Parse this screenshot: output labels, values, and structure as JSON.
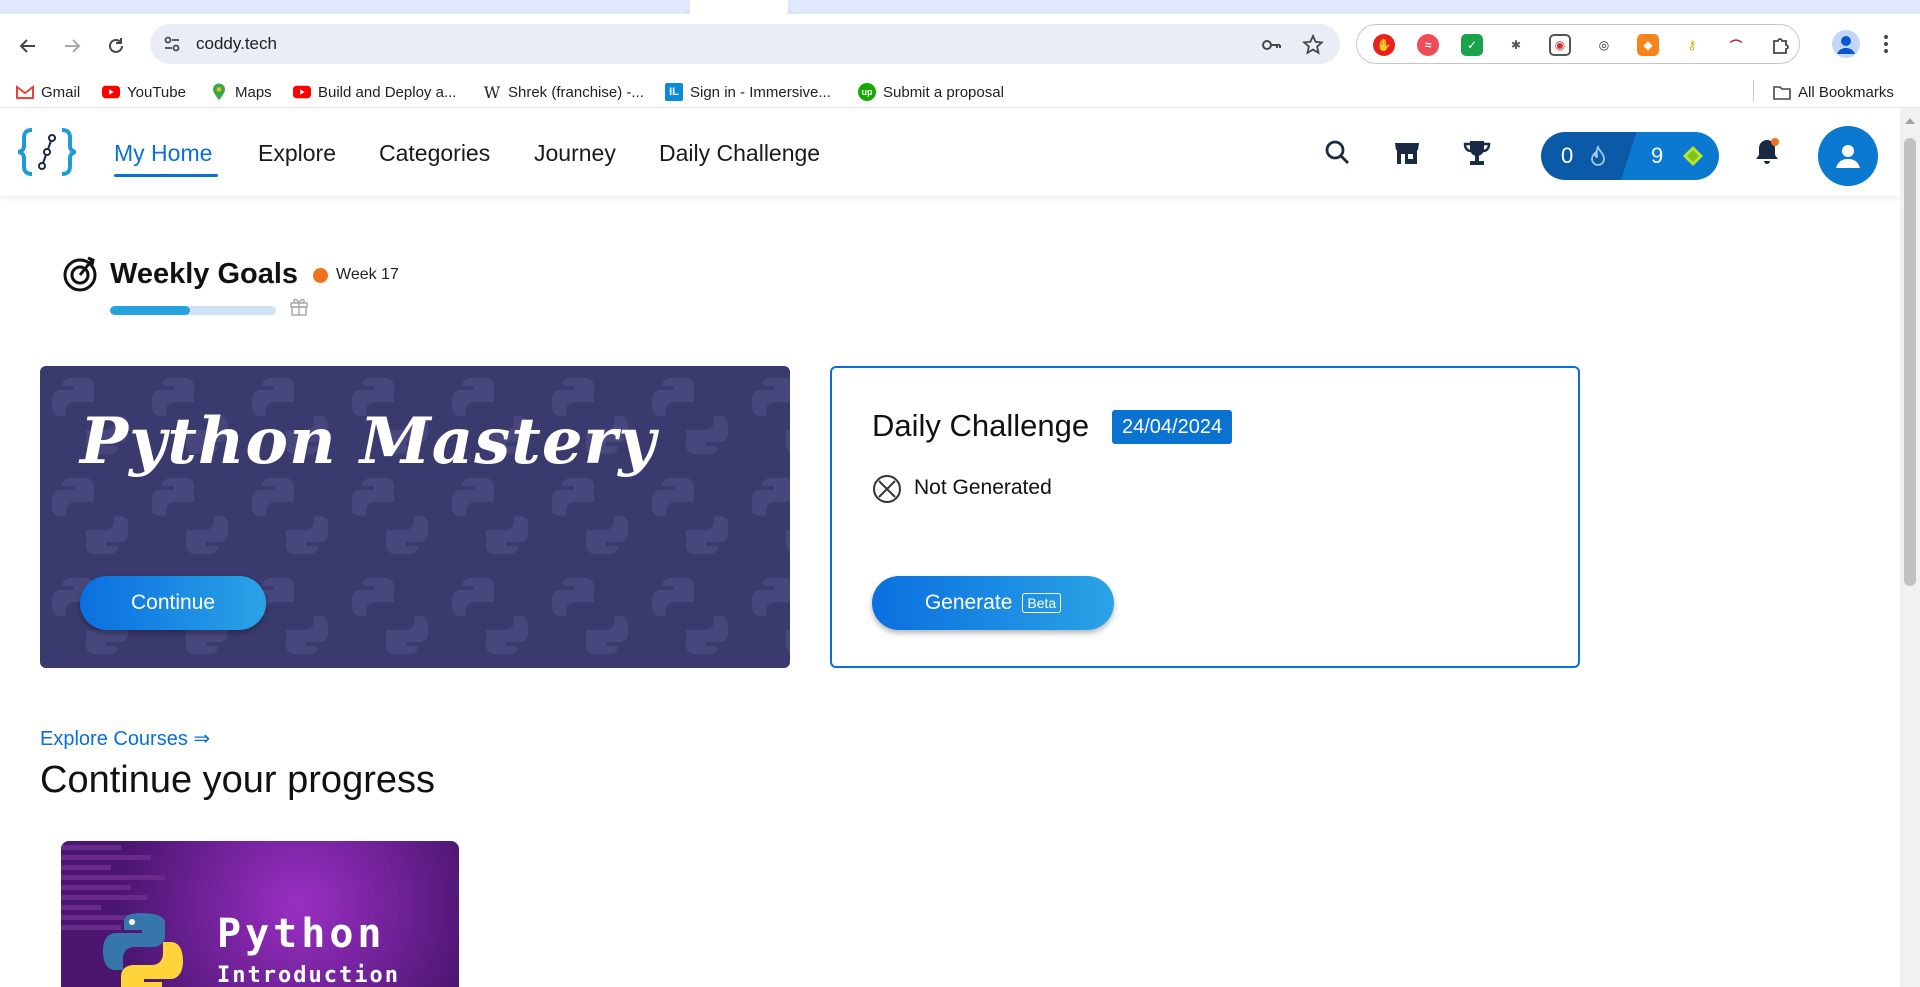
{
  "browser": {
    "url": "coddy.tech",
    "bookmarks": [
      {
        "label": "Gmail",
        "icon": "gmail-icon"
      },
      {
        "label": "YouTube",
        "icon": "youtube-icon"
      },
      {
        "label": "Maps",
        "icon": "maps-icon"
      },
      {
        "label": "Build and Deploy a...",
        "icon": "youtube-icon"
      },
      {
        "label": "Shrek (franchise) -...",
        "icon": "wikipedia-icon"
      },
      {
        "label": "Sign in - Immersive...",
        "icon": "immersive-icon"
      },
      {
        "label": "Submit a proposal",
        "icon": "upwork-icon"
      }
    ],
    "all_bookmarks": "All Bookmarks"
  },
  "header": {
    "nav": [
      "My Home",
      "Explore",
      "Categories",
      "Journey",
      "Daily Challenge"
    ],
    "active_nav": "My Home",
    "streak": "0",
    "gems": "9",
    "colors": {
      "accent": "#0a6fd6",
      "pill_dark": "#0a5aa8",
      "pill_light": "#0b79d0"
    }
  },
  "weekly_goals": {
    "title": "Weekly Goals",
    "week": "Week 17",
    "progress_fraction": 0.48
  },
  "banner": {
    "title": "Python Mastery",
    "button": "Continue",
    "bg_color": "#3a3a6e"
  },
  "daily_challenge": {
    "title": "Daily Challenge",
    "date": "24/04/2024",
    "status": "Not Generated",
    "button": "Generate",
    "badge": "Beta"
  },
  "main": {
    "explore_link": "Explore Courses ⇒",
    "section_title": "Continue your progress"
  },
  "course": {
    "title_line1": "Python",
    "title_line2": "Introduction"
  }
}
